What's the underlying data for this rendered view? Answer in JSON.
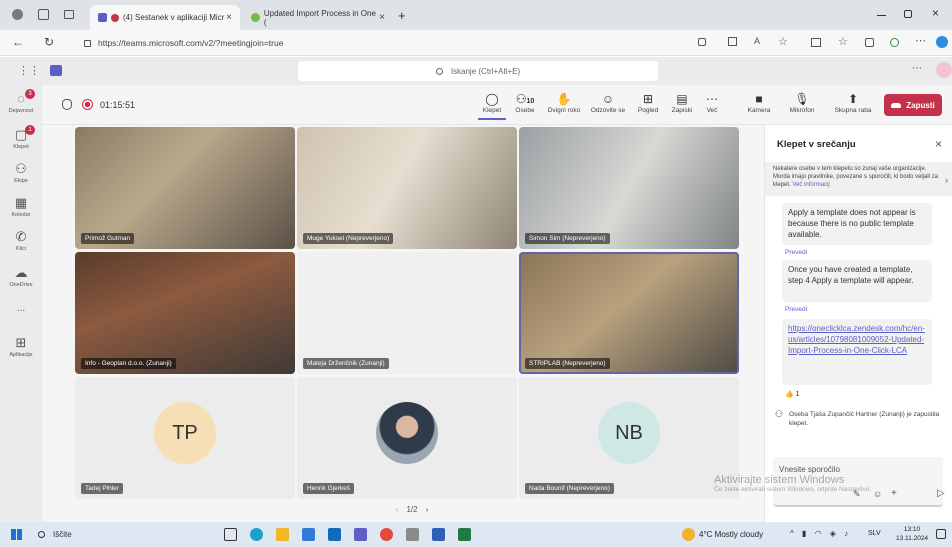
{
  "browser": {
    "tabs": [
      {
        "label": "(4) Sestanek v aplikaciji Micr",
        "close": "×"
      },
      {
        "label": "Updated Import Process in One (",
        "close": "×"
      }
    ],
    "new_tab": "+",
    "url": "https://teams.microsoft.com/v2/?meetingjoin=true"
  },
  "teams": {
    "search_placeholder": "Iskanje (Ctrl+Alt+E)",
    "rail": [
      {
        "label": "Dejavnost",
        "icon": "bell-icon",
        "badge": "3"
      },
      {
        "label": "Klepet",
        "icon": "chat-icon",
        "badge": "1"
      },
      {
        "label": "Ekipe",
        "icon": "teams-icon"
      },
      {
        "label": "Koledar",
        "icon": "calendar-icon"
      },
      {
        "label": "Klici",
        "icon": "phone-icon"
      },
      {
        "label": "OneDrive",
        "icon": "cloud-icon"
      },
      {
        "label": "...",
        "icon": "more-icon"
      },
      {
        "label": "Aplikacije",
        "icon": "apps-icon"
      }
    ]
  },
  "meeting": {
    "timer": "01:15:51",
    "toolbar": [
      {
        "label": "Klepet",
        "icon": "chat-icon"
      },
      {
        "label": "Osebe",
        "icon": "people-icon",
        "count": "10"
      },
      {
        "label": "Dvigni roko",
        "icon": "hand-icon"
      },
      {
        "label": "Odzovite se",
        "icon": "emoji-icon"
      },
      {
        "label": "Pogled",
        "icon": "grid-icon"
      },
      {
        "label": "Zapiski",
        "icon": "notes-icon"
      },
      {
        "label": "Več",
        "icon": "more-icon"
      },
      {
        "label": "Kamera",
        "icon": "camera-icon"
      },
      {
        "label": "Mikrofon",
        "icon": "mic-off-icon"
      },
      {
        "label": "Skupna raba",
        "icon": "share-icon"
      }
    ],
    "leave_label": "Zapusti",
    "participants": [
      {
        "name": "Primož Gutman",
        "type": "video"
      },
      {
        "name": "Muge Yuksel (Nepreverjeno)",
        "type": "video"
      },
      {
        "name": "Simon Sim (Nepreverjeno)",
        "type": "video"
      },
      {
        "name": "Info - Geoplan d.o.o. (Zunanji)",
        "type": "video"
      },
      {
        "name": "Mateja Drženčnik (Zunanji)",
        "type": "empty"
      },
      {
        "name": "STRIPLAB (Nepreverjeno)",
        "type": "video"
      },
      {
        "name": "Tadej Pihler",
        "type": "avatar",
        "initials": "TP",
        "color": "#f6dfb4"
      },
      {
        "name": "Henrik Gjerkeš",
        "type": "photo"
      },
      {
        "name": "Nada Bounif (Nepreverjeno)",
        "type": "avatar",
        "initials": "NB",
        "color": "#cfe8e6"
      }
    ],
    "pagination": "1/2"
  },
  "chat": {
    "title": "Klepet v srečanju",
    "notice": "Nekatere osebe v tem klepetu so zunaj vaše organizacije. Morda imajo pravilnike, povezane s sporočili, ki bodo veljali za klepet.",
    "notice_link": "Več informacij",
    "messages": [
      {
        "text": "Apply a template does not appear is because there is no public template available."
      },
      {
        "text": "Once you have created a template, step 4 Apply a template will appear."
      },
      {
        "text": "https://oneclicklca.zendesk.com/hc/en-us/articles/10798081009052-Updated-Import-Process-in-One-Click-LCA",
        "reaction": "👍 1"
      }
    ],
    "translate": "Prevedi",
    "system_msg": "Oseba Tjaša Zupančič Hartner (Zunanji) je zapustila klepet.",
    "input_placeholder": "Vnesite sporočilo"
  },
  "watermark": {
    "title": "Aktivirajte sistem Windows",
    "sub": "Če želite aktivirati sistem Windows, odprite Nastavitve."
  },
  "taskbar": {
    "search": "Iščite",
    "weather": "4°C Mostly cloudy",
    "lang": "SLV",
    "time": "13:10",
    "date": "13.11.2024"
  },
  "colors": {
    "accent": "#5b5fc7",
    "leave": "#c4314b",
    "taskbar": "#dfe7f2"
  }
}
